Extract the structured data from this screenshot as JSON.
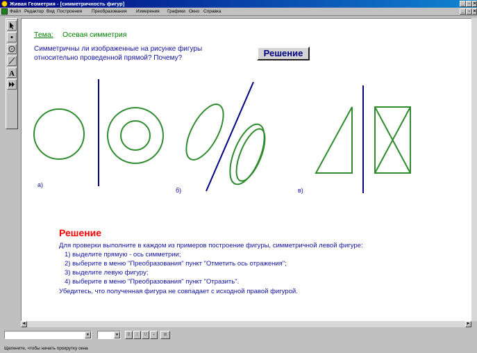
{
  "window": {
    "title": "Живая Геометрия - [симметричность фигур]"
  },
  "menu": [
    "Файл",
    "Редактор",
    "Вид",
    "Построения",
    "Преобразования",
    "Измерения",
    "Графики",
    "Окно",
    "Справка"
  ],
  "content": {
    "topic_label": "Тема:",
    "topic_value": "Осевая симметрия",
    "question": "Симметричны ли изображенные на рисунке фигуры\nотносительно проведенной прямой? Почему?",
    "solution_button": "Решение",
    "figure_labels": [
      "а)",
      "б)",
      "в)"
    ],
    "solution": {
      "title": "Решение",
      "intro": "Для проверки выполните в каждом из примеров построение фигуры, симметричной левой фигуре:",
      "steps": [
        "1) выделите прямую - ось симметрии;",
        "2) выберите в меню \"Преобразования\" пункт \"Отметить ось отражения\";",
        "3) выделите левую фигуру;",
        "4) выберите в меню \"Преобразования\" пункт \"Отразить\"."
      ],
      "conclusion": "Убедитесь, что полученная фигура не совпадает с исходной правой фигурой."
    }
  },
  "status": {
    "text": "Щелкните, чтобы начать прокрутку окна"
  },
  "colors": {
    "figure": "#2e8b2e",
    "axis": "#000080",
    "text": "#1010a0",
    "solution_title": "#ff0000",
    "topic": "#008000"
  },
  "icons": {
    "tools": [
      "arrow-tool-icon",
      "point-tool-icon",
      "compass-tool-icon",
      "line-tool-icon",
      "text-tool-icon",
      "script-tool-icon"
    ]
  }
}
